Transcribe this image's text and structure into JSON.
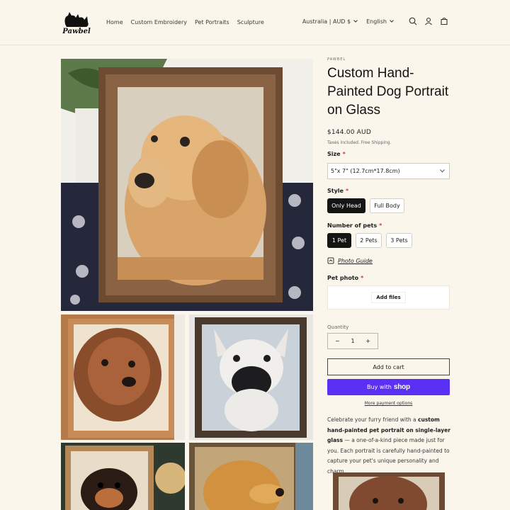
{
  "brand": {
    "logo_text": "Pawbel"
  },
  "nav": {
    "items": [
      "Home",
      "Custom Embroidery",
      "Pet Portraits",
      "Sculpture"
    ]
  },
  "header": {
    "country": "Australia | AUD $",
    "language": "English",
    "icons": [
      "search-icon",
      "account-icon",
      "cart-icon"
    ]
  },
  "product": {
    "vendor": "PAWBEL",
    "title": "Custom Hand-Painted Dog Portrait on Glass",
    "price": "$144.00 AUD",
    "tax_note": "Taxes included. Free Shipping.",
    "size": {
      "label": "Size",
      "required": "*",
      "selected": "5\"x 7\"  (12.7cm*17.8cm)"
    },
    "style": {
      "label": "Style",
      "required": "*",
      "options": [
        "Only Head",
        "Full Body"
      ],
      "selected": "Only Head"
    },
    "pets": {
      "label": "Number of pets",
      "required": "*",
      "options": [
        "1 Pet",
        "2 Pets",
        "3 Pets"
      ],
      "selected": "1 Pet"
    },
    "photo_guide": "Photo Guide",
    "pet_photo": {
      "label": "Pet photo",
      "required": "*",
      "button": "Add files"
    },
    "quantity": {
      "label": "Quantity",
      "value": "1",
      "minus": "−",
      "plus": "+"
    },
    "add_to_cart": "Add to cart",
    "buy_with": "Buy with",
    "shop_word": "shop",
    "more_payment": "More payment options",
    "description": {
      "p1": "Celebrate your furry friend with a ",
      "b1": "custom hand-painted pet portrait on single-layer glass",
      "p2": " — a one-of-a-kind piece made just for you. Each portrait is carefully hand-painted to capture your pet's unique personality and charm."
    }
  },
  "colors": {
    "background": "#fbf6ec",
    "accent": "#5a31f4",
    "required": "#d9343f",
    "selected_pill": "#141414"
  }
}
